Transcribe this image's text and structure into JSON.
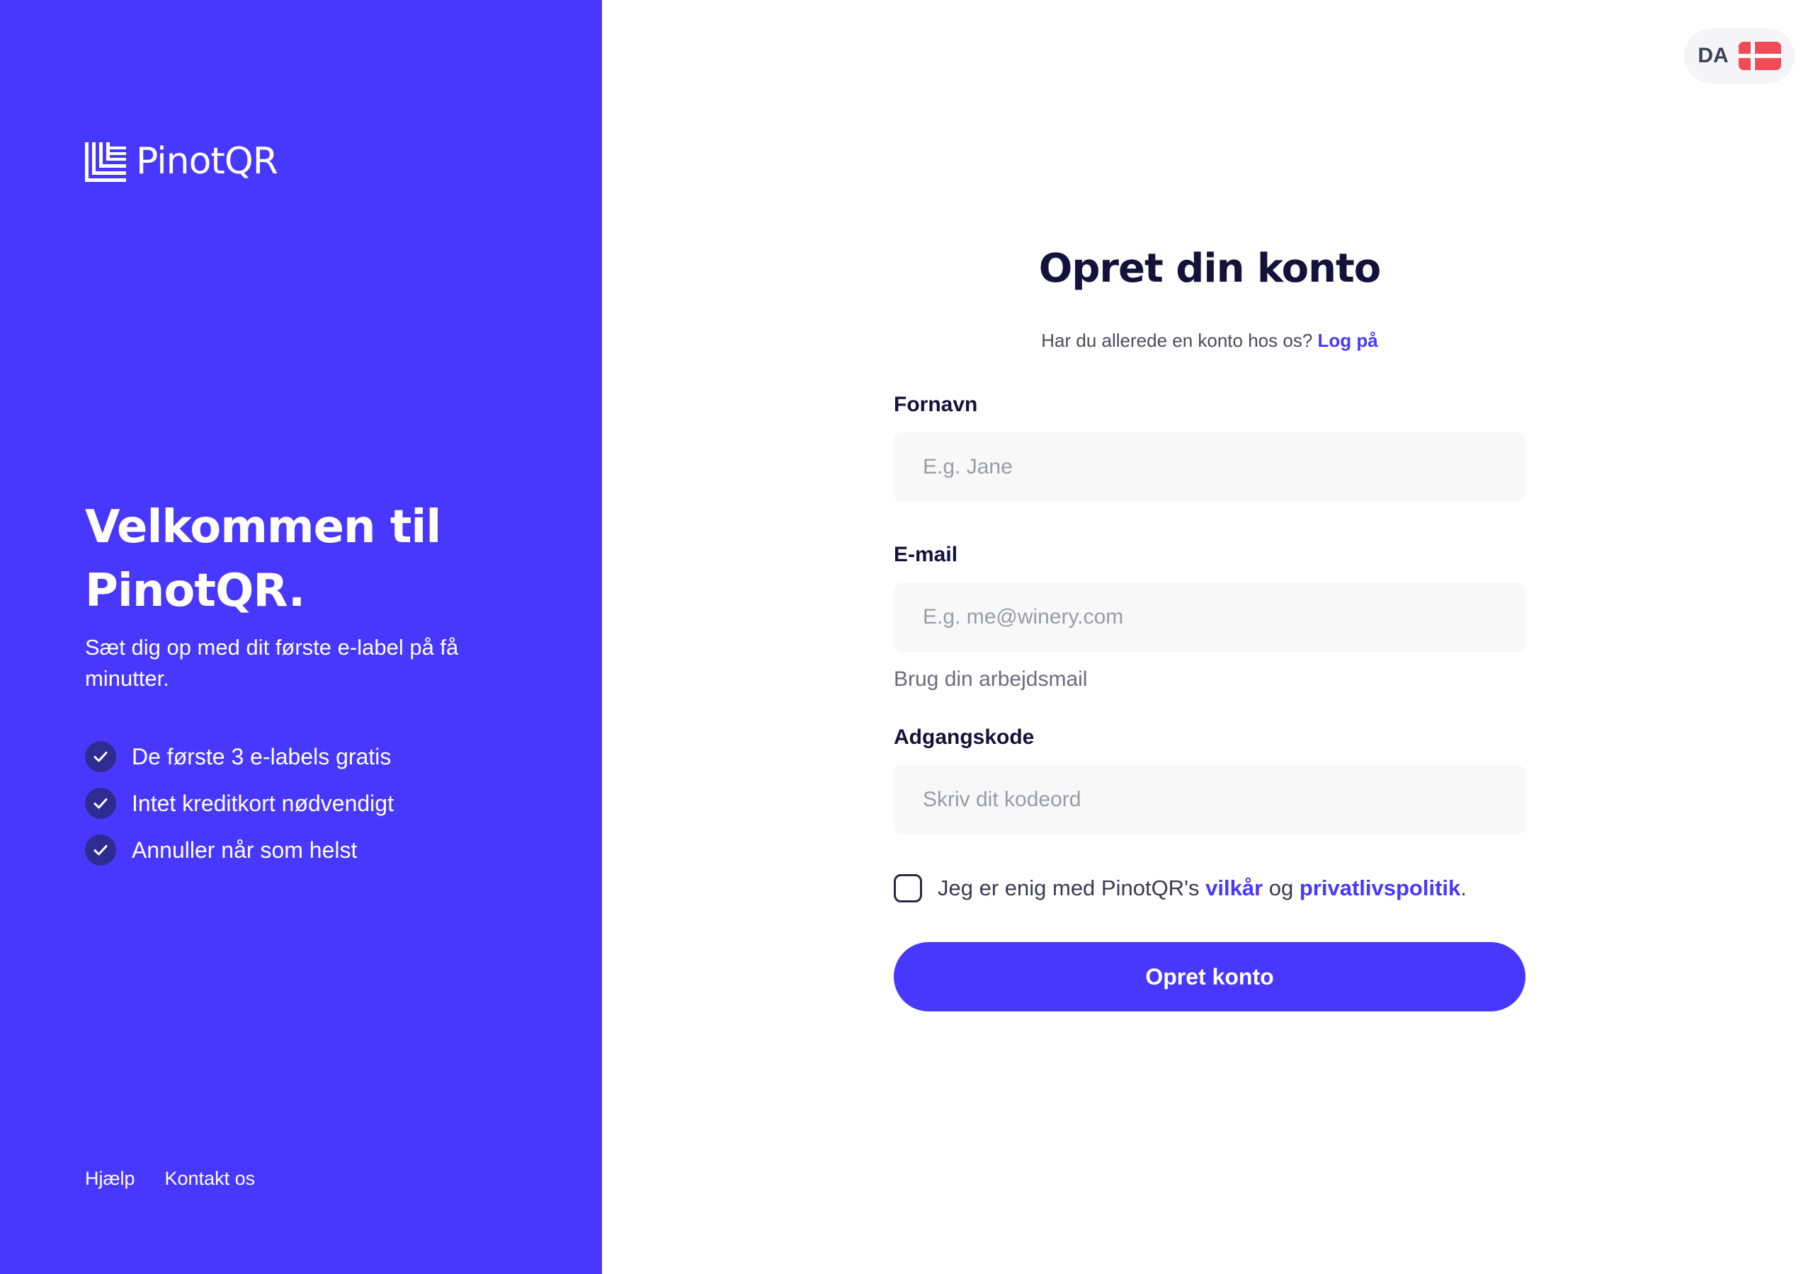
{
  "brand": {
    "name": "PinotQR",
    "accent": "#4838fe"
  },
  "left_panel": {
    "welcome_line1": "Velkommen til",
    "welcome_line2": "PinotQR.",
    "subtitle": "Sæt dig op med dit første e-label på få minutter.",
    "features": [
      "De første 3 e-labels gratis",
      "Intet kreditkort nødvendigt",
      "Annuller når som helst"
    ],
    "footer": {
      "help": "Hjælp",
      "contact": "Kontakt os"
    }
  },
  "language": {
    "code": "DA",
    "flag_icon": "denmark-flag-icon"
  },
  "form": {
    "title": "Opret din konto",
    "login_prompt": "Har du allerede en konto hos os?",
    "login_link": "Log på",
    "first_name": {
      "label": "Fornavn",
      "placeholder": "E.g. Jane",
      "value": ""
    },
    "email": {
      "label": "E-mail",
      "placeholder": "E.g. me@winery.com",
      "value": "",
      "hint": "Brug din arbejdsmail"
    },
    "password": {
      "label": "Adgangskode",
      "placeholder": "Skriv dit kodeord",
      "value": ""
    },
    "agree": {
      "checked": false,
      "text_before": "Jeg er enig med PinotQR's",
      "terms": "vilkår",
      "and": "og",
      "privacy": "privatlivspolitik",
      "period": "."
    },
    "submit": "Opret konto"
  }
}
